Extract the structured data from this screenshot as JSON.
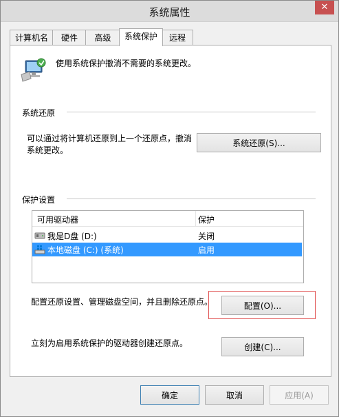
{
  "window": {
    "title": "系统属性",
    "close_glyph": "✕"
  },
  "tabs": [
    {
      "label": "计算机名"
    },
    {
      "label": "硬件"
    },
    {
      "label": "高级"
    },
    {
      "label": "系统保护",
      "active": true
    },
    {
      "label": "远程"
    }
  ],
  "intro": {
    "text": "使用系统保护撤消不需要的系统更改。",
    "icon": "computer-protect-icon"
  },
  "restore": {
    "section_title": "系统还原",
    "description_line1": "可以通过将计算机还原到上一个还原点，撤消",
    "description_line2": "系统更改。",
    "button_label": "系统还原(S)..."
  },
  "protection": {
    "section_title": "保护设置",
    "columns": [
      "可用驱动器",
      "保护"
    ],
    "drives": [
      {
        "name": "我是D盘 (D:)",
        "status": "关闭",
        "icon": "removable-drive-icon",
        "selected": false
      },
      {
        "name": "本地磁盘 (C:) (系统)",
        "status": "启用",
        "icon": "windows-drive-icon",
        "selected": true
      }
    ],
    "configure_text": "配置还原设置、管理磁盘空间，并且删除还原点。",
    "configure_button": "配置(O)...",
    "create_text": "立刻为启用系统保护的驱动器创建还原点。",
    "create_button": "创建(C)..."
  },
  "footer": {
    "ok": "确定",
    "cancel": "取消",
    "apply": "应用(A)"
  },
  "colors": {
    "selection": "#3399ff",
    "highlight_border": "#e05050",
    "close_button": "#c75050"
  }
}
